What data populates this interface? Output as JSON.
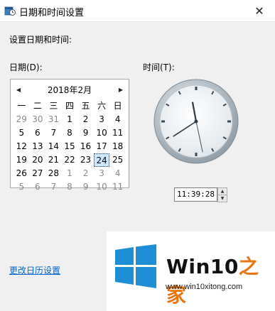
{
  "window": {
    "title": "日期和时间设置",
    "close_glyph": "✕"
  },
  "content": {
    "heading": "设置日期和时间:",
    "date_label": "日期(D):",
    "time_label": "时间(T):",
    "link_text": "更改日历设置"
  },
  "calendar": {
    "month_label": "2018年2月",
    "prev_glyph": "◀",
    "next_glyph": "▶",
    "weekdays": [
      "一",
      "二",
      "三",
      "四",
      "五",
      "六",
      "日"
    ],
    "weeks": [
      [
        "29",
        "30",
        "31",
        "1",
        "2",
        "3",
        "4"
      ],
      [
        "5",
        "6",
        "7",
        "8",
        "9",
        "10",
        "11"
      ],
      [
        "12",
        "13",
        "14",
        "15",
        "16",
        "17",
        "18"
      ],
      [
        "19",
        "20",
        "21",
        "22",
        "23",
        "24",
        "25"
      ],
      [
        "26",
        "27",
        "28",
        "1",
        "2",
        "3",
        "4"
      ],
      [
        "5",
        "6",
        "7",
        "8",
        "9",
        "10",
        "11"
      ]
    ],
    "other_month_mask": [
      [
        true,
        true,
        true,
        false,
        false,
        false,
        false
      ],
      [
        false,
        false,
        false,
        false,
        false,
        false,
        false
      ],
      [
        false,
        false,
        false,
        false,
        false,
        false,
        false
      ],
      [
        false,
        false,
        false,
        false,
        false,
        false,
        false
      ],
      [
        false,
        false,
        false,
        true,
        true,
        true,
        true
      ],
      [
        true,
        true,
        true,
        true,
        true,
        true,
        true
      ]
    ],
    "selected_week": 3,
    "selected_day_index": 5
  },
  "clock": {
    "hour": 11,
    "minute": 39,
    "second": 28
  },
  "time_spinner": {
    "value": "11:39:28",
    "up_glyph": "▲",
    "down_glyph": "▼"
  },
  "watermark": {
    "brand_part1": "Win10",
    "brand_part2": "之家",
    "url": "www.win10xitong.com",
    "logo_color": "#1e8fd6"
  }
}
